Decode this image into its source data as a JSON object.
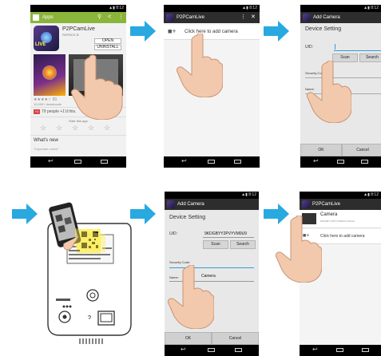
{
  "screen1": {
    "status_time": "▲▮ 8:12",
    "bar_title": "Apps",
    "app_name": "P2PCamLive",
    "developer": "PATRICK B",
    "open_label": "OPEN",
    "uninstall_label": "UNINSTALL",
    "live_badge": "LIVE",
    "rating_count": "81",
    "downloads": "10,000+ downloads",
    "date": "Mar 11, 2014",
    "size": "2.47MB",
    "plus_count": "79 people +1'd this.",
    "rate_label": "Rate this app",
    "whats_new": "What's new",
    "important_notice": "\"Important notice\""
  },
  "screen2": {
    "status_time": "▲▮ 8:12",
    "bar_title": "P2PCamLive",
    "add_camera_label": "Click here to add camera"
  },
  "screen3": {
    "status_time": "▲▮ 8:12",
    "bar_title": "Add Camera",
    "section_title": "Device Setting",
    "uid_label": "UID:",
    "scan_label": "Scan",
    "search_label": "Search",
    "security_label": "Security Code:",
    "name_label": "Name:",
    "ok_label": "OK",
    "cancel_label": "Cancel"
  },
  "screen4": {
    "status_time": "▲▮ 8:12",
    "bar_title": "Add Camera",
    "section_title": "Device Setting",
    "uid_label": "UID:",
    "uid_value": "9KDGBYY2PVYVM9U9",
    "scan_label": "Scan",
    "search_label": "Search",
    "security_label": "Security Code:",
    "name_label": "Name:",
    "name_value": "Camera",
    "ok_label": "OK",
    "cancel_label": "Cancel"
  },
  "screen5": {
    "status_time": "▲▮ 8:12",
    "bar_title": "P2PCamLive",
    "camera_name": "Camera",
    "camera_uid": "9KDGBYY2PVYVM9U9 (Online)",
    "add_camera_label": "Click here to add camera"
  },
  "colors": {
    "arrow": "#29a9e0",
    "play_bar": "#8bb53a",
    "app_bar": "#2d2d2d",
    "holo_blue": "#2f9fd6"
  }
}
